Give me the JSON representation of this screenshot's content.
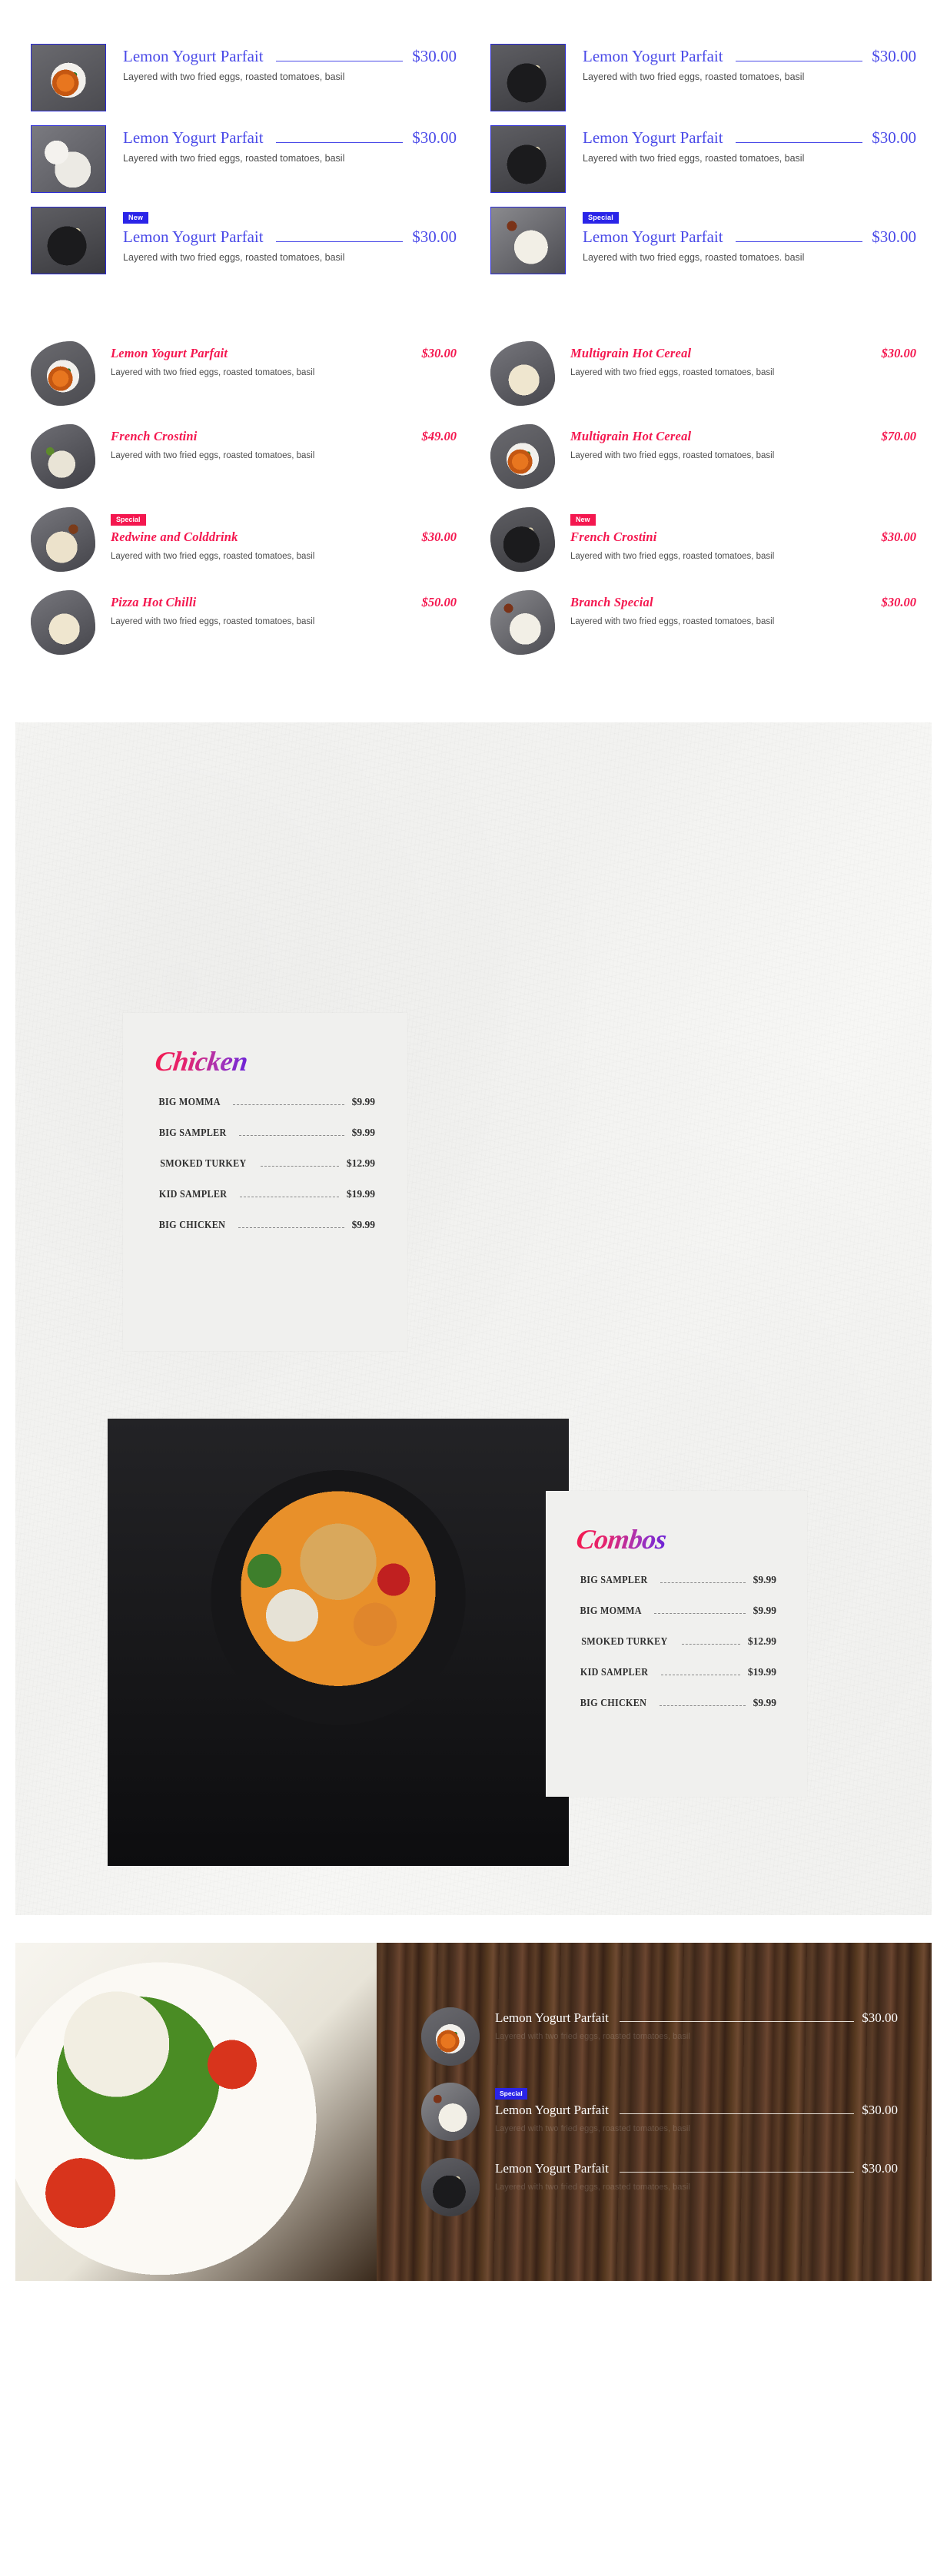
{
  "section_blue": {
    "name": "blue-serif-menu-grid",
    "items": [
      {
        "badge": null,
        "name": "Lemon Yogurt Parfait",
        "price": "$30.00",
        "desc": "Layered with two fried eggs, roasted tomatoes, basil",
        "thumb": "noodle-bowl-photo"
      },
      {
        "badge": null,
        "name": "Lemon Yogurt Parfait",
        "price": "$30.00",
        "desc": "Layered with two fried eggs, roasted tomatoes, basil",
        "thumb": "skewer-bowl-photo"
      },
      {
        "badge": null,
        "name": "Lemon Yogurt Parfait",
        "price": "$30.00",
        "desc": "Layered with two fried eggs, roasted tomatoes, basil",
        "thumb": "sauce-dish-photo"
      },
      {
        "badge": null,
        "name": "Lemon Yogurt Parfait",
        "price": "$30.00",
        "desc": "Layered with two fried eggs, roasted tomatoes, basil",
        "thumb": "skewer-bowl-photo"
      },
      {
        "badge": "New",
        "name": "Lemon Yogurt Parfait",
        "price": "$30.00",
        "desc": "Layered with two fried eggs, roasted tomatoes, basil",
        "thumb": "skewer-bowl-photo"
      },
      {
        "badge": "Special",
        "name": "Lemon Yogurt Parfait",
        "price": "$30.00",
        "desc": "Layered with two fried eggs, roasted tomatoes. basil",
        "thumb": "dumpling-plate-photo"
      }
    ],
    "accent_color": "#4a4ae8",
    "badge_color": "#2a24e8"
  },
  "section_pink": {
    "name": "crimson-script-menu-grid",
    "items": [
      {
        "badge": null,
        "name": "Lemon Yogurt Parfait",
        "price": "$30.00",
        "desc": "Layered with two fried eggs, roasted tomatoes, basil",
        "thumb": "noodle-bowl-photo"
      },
      {
        "badge": null,
        "name": "Multigrain Hot Cereal",
        "price": "$30.00",
        "desc": "Layered with two fried eggs, roasted tomatoes, basil",
        "thumb": "veggie-pan-photo"
      },
      {
        "badge": null,
        "name": "French Crostini",
        "price": "$49.00",
        "desc": "Layered with two fried eggs, roasted tomatoes, basil",
        "thumb": "sushi-roll-photo"
      },
      {
        "badge": null,
        "name": "Multigrain Hot Cereal",
        "price": "$70.00",
        "desc": "Layered with two fried eggs, roasted tomatoes, basil",
        "thumb": "mussel-bowl-photo"
      },
      {
        "badge": "Special",
        "name": "Redwine and Colddrink",
        "price": "$30.00",
        "desc": "Layered with two fried eggs, roasted tomatoes, basil",
        "thumb": "gyoza-board-photo"
      },
      {
        "badge": "New",
        "name": "French Crostini",
        "price": "$30.00",
        "desc": "Layered with two fried eggs, roasted tomatoes, basil",
        "thumb": "skewer-bowl-photo"
      },
      {
        "badge": null,
        "name": "Pizza Hot Chilli",
        "price": "$50.00",
        "desc": "Layered with two fried eggs, roasted tomatoes, basil",
        "thumb": "veggie-pan-photo"
      },
      {
        "badge": null,
        "name": "Branch Special",
        "price": "$30.00",
        "desc": "Layered with two fried eggs, roasted tomatoes, basil",
        "thumb": "bao-plate-photo"
      }
    ],
    "accent_color": "#f4174f",
    "badge_color": "#f4174f"
  },
  "section_paper": {
    "name": "textured-card-section",
    "background_color": "#f4f4f2",
    "cards": [
      {
        "title": "Chicken",
        "photo": "steamed-bao-photo",
        "items": [
          {
            "name": "BIG MOMMA",
            "price": "$9.99"
          },
          {
            "name": "BIG SAMPLER",
            "price": "$9.99"
          },
          {
            "name": "SMOKED TURKEY",
            "price": "$12.99"
          },
          {
            "name": "KID SAMPLER",
            "price": "$19.99"
          },
          {
            "name": "BIG CHICKEN",
            "price": "$9.99"
          }
        ]
      },
      {
        "title": "Combos",
        "photo": "ramen-pan-photo",
        "items": [
          {
            "name": "BIG SAMPLER",
            "price": "$9.99"
          },
          {
            "name": "BIG MOMMA",
            "price": "$9.99"
          },
          {
            "name": "SMOKED TURKEY",
            "price": "$12.99"
          },
          {
            "name": "KID SAMPLER",
            "price": "$19.99"
          },
          {
            "name": "BIG CHICKEN",
            "price": "$9.99"
          }
        ]
      }
    ],
    "title_gradient": [
      "#f31a4f",
      "#6b22d8"
    ]
  },
  "section_split": {
    "name": "salad-wood-split-section",
    "left_photo": "arugula-salad-photo",
    "background": "dark-wood-texture",
    "items": [
      {
        "badge": null,
        "name": "Lemon Yogurt Parfait",
        "price": "$30.00",
        "desc": "Layered with two fried eggs, roasted tomatoes, basil",
        "thumb": "noodle-bowl-photo"
      },
      {
        "badge": "Special",
        "name": "Lemon Yogurt Parfait",
        "price": "$30.00",
        "desc": "Layered with two fried eggs, roasted tomatoes, basil",
        "thumb": "dumpling-plate-photo"
      },
      {
        "badge": null,
        "name": "Lemon Yogurt Parfait",
        "price": "$30.00",
        "desc": "Layered with two fried eggs, roasted tomatoes, basil",
        "thumb": "skewer-bowl-photo"
      }
    ],
    "badge_color": "#2a24e8"
  }
}
